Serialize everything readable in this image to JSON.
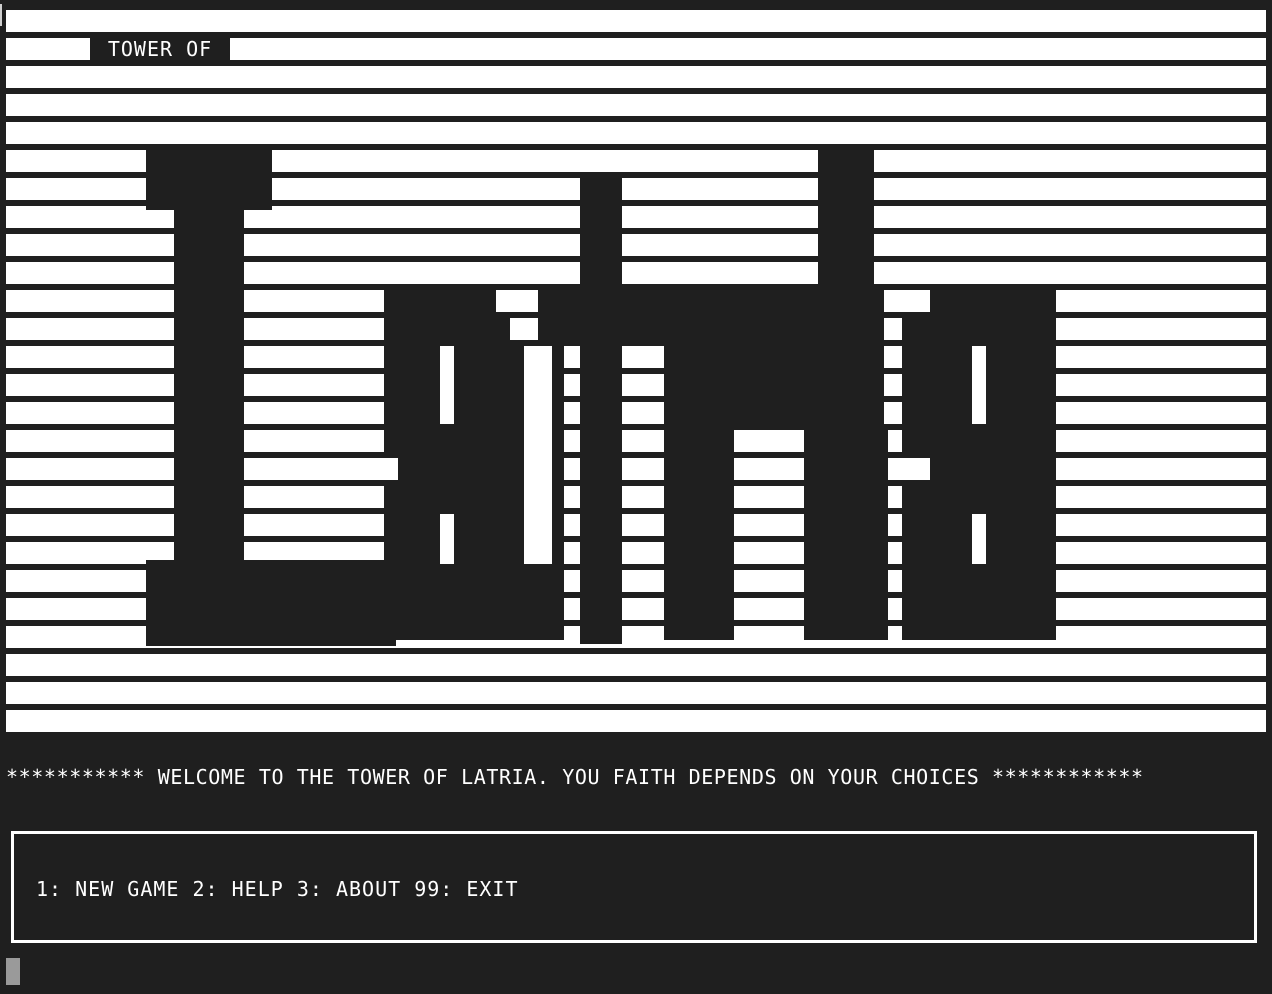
{
  "banner": {
    "title": "TOWER OF",
    "logo_word": "Latria"
  },
  "welcome": {
    "text": "*********** WELCOME TO THE TOWER OF LATRIA. YOU FAITH DEPENDS ON YOUR CHOICES ************"
  },
  "menu": {
    "text": "1: NEW GAME 2: HELP 3: ABOUT 99: EXIT"
  },
  "colors": {
    "background": "#1f1f1f",
    "foreground": "#ffffff",
    "cursor": "#9a9a9a"
  }
}
